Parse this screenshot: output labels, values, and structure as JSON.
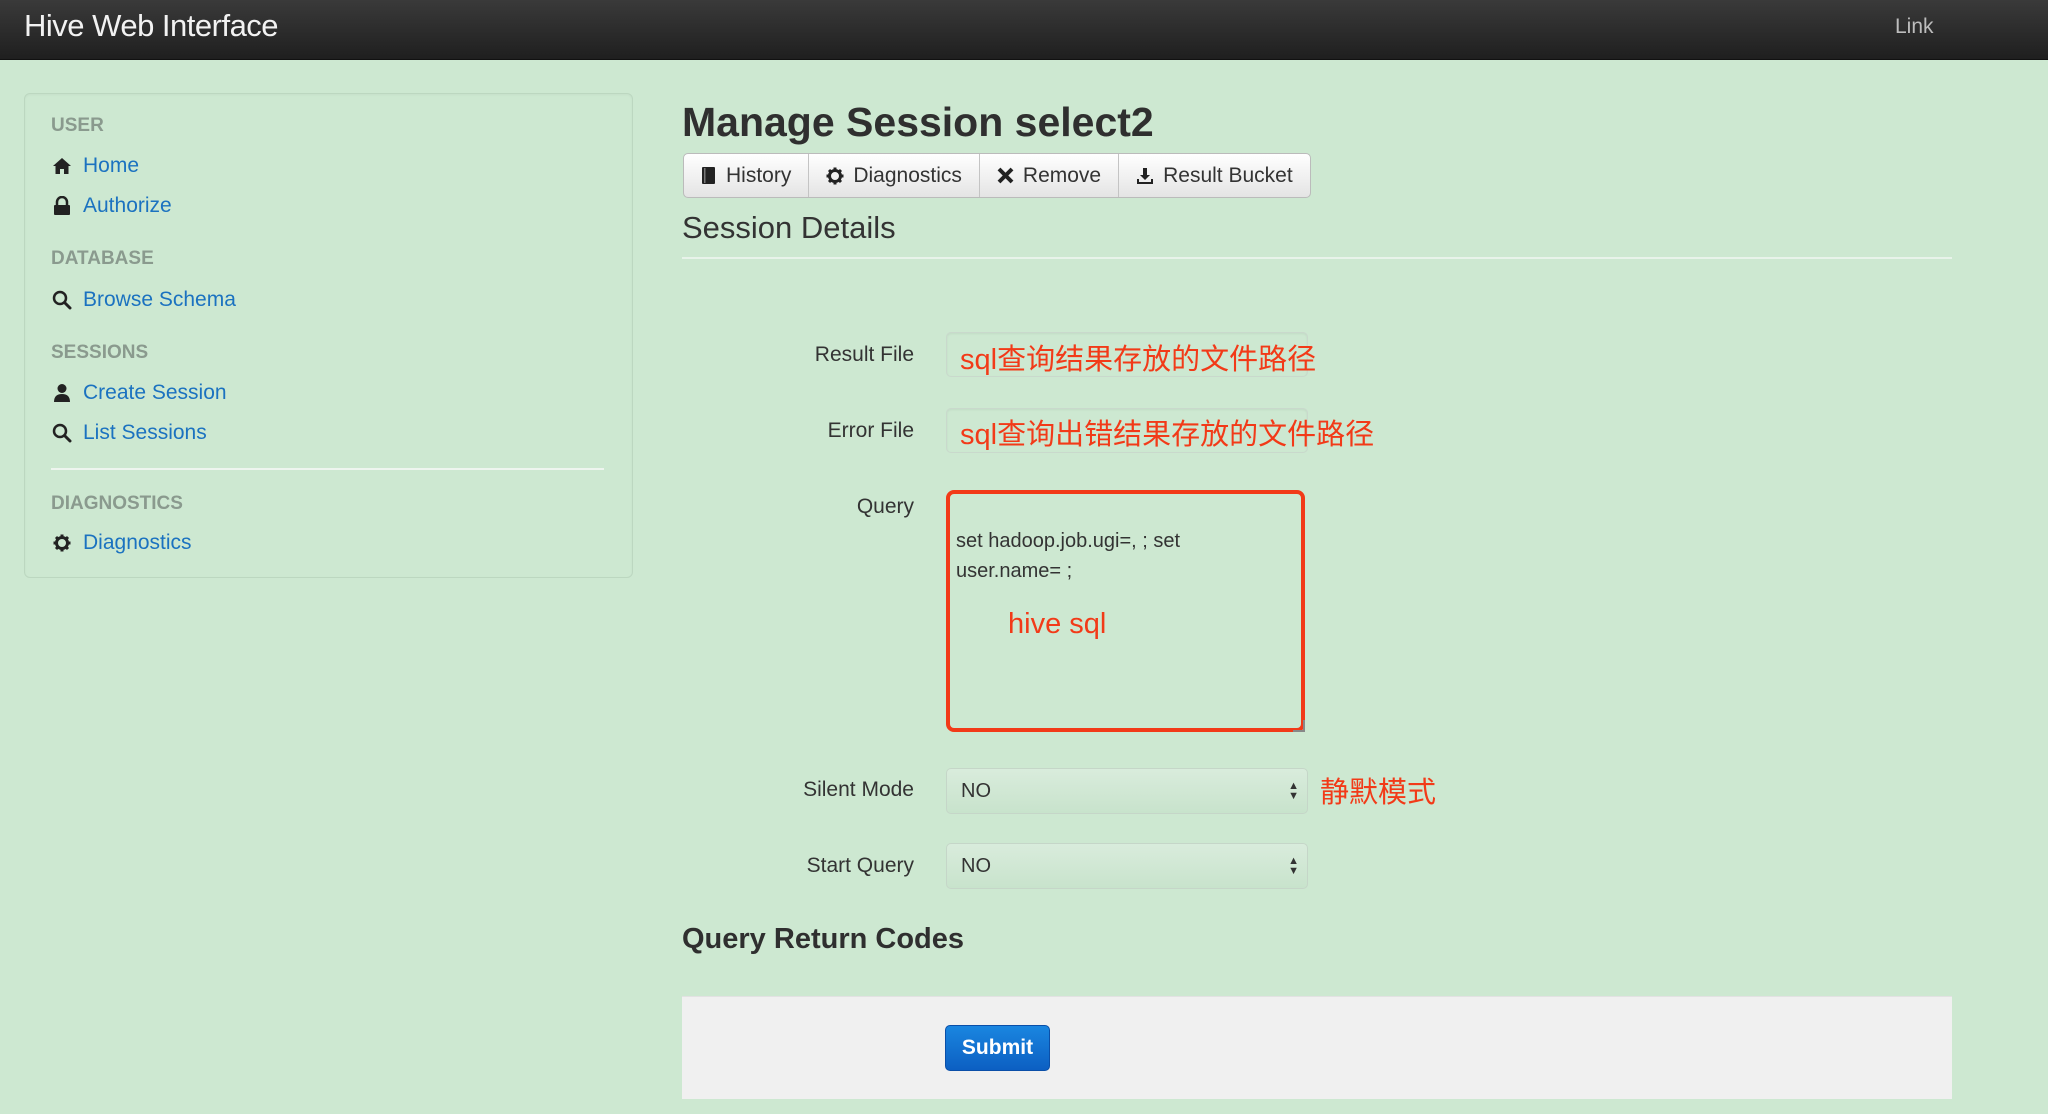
{
  "navbar": {
    "brand": "Hive Web Interface",
    "link": "Link"
  },
  "sidebar": {
    "sections": [
      {
        "header": "USER",
        "items": [
          {
            "icon": "home-icon",
            "label": "Home"
          },
          {
            "icon": "lock-icon",
            "label": "Authorize"
          }
        ]
      },
      {
        "header": "DATABASE",
        "items": [
          {
            "icon": "search-icon",
            "label": "Browse Schema"
          }
        ]
      },
      {
        "header": "SESSIONS",
        "items": [
          {
            "icon": "user-icon",
            "label": "Create Session"
          },
          {
            "icon": "search-icon",
            "label": "List Sessions"
          }
        ]
      },
      {
        "header": "DIAGNOSTICS",
        "items": [
          {
            "icon": "gear-icon",
            "label": "Diagnostics"
          }
        ]
      }
    ]
  },
  "main": {
    "title": "Manage Session select2",
    "actions": [
      {
        "icon": "book-icon",
        "label": "History"
      },
      {
        "icon": "gear-icon",
        "label": "Diagnostics"
      },
      {
        "icon": "remove-icon",
        "label": "Remove"
      },
      {
        "icon": "download-icon",
        "label": "Result Bucket"
      }
    ],
    "section_title": "Session Details",
    "form": {
      "result_file": {
        "label": "Result File",
        "value": ""
      },
      "error_file": {
        "label": "Error File",
        "value": ""
      },
      "query": {
        "label": "Query",
        "value": "set hadoop.job.ugi=, ; set user.name= ;"
      },
      "silent_mode": {
        "label": "Silent Mode",
        "value": "NO"
      },
      "start_query": {
        "label": "Start Query",
        "value": "NO"
      }
    },
    "codes_title": "Query Return Codes",
    "submit_label": "Submit"
  },
  "annotations": {
    "result_file": "sql查询结果存放的文件路径",
    "error_file": "sql查询出错结果存放的文件路径",
    "query": "hive sql",
    "silent_mode": "静默模式"
  },
  "colors": {
    "background": "#cde8d1",
    "link": "#1b72c0",
    "annotation": "#f23a18",
    "primary": "#0c5fc2"
  }
}
